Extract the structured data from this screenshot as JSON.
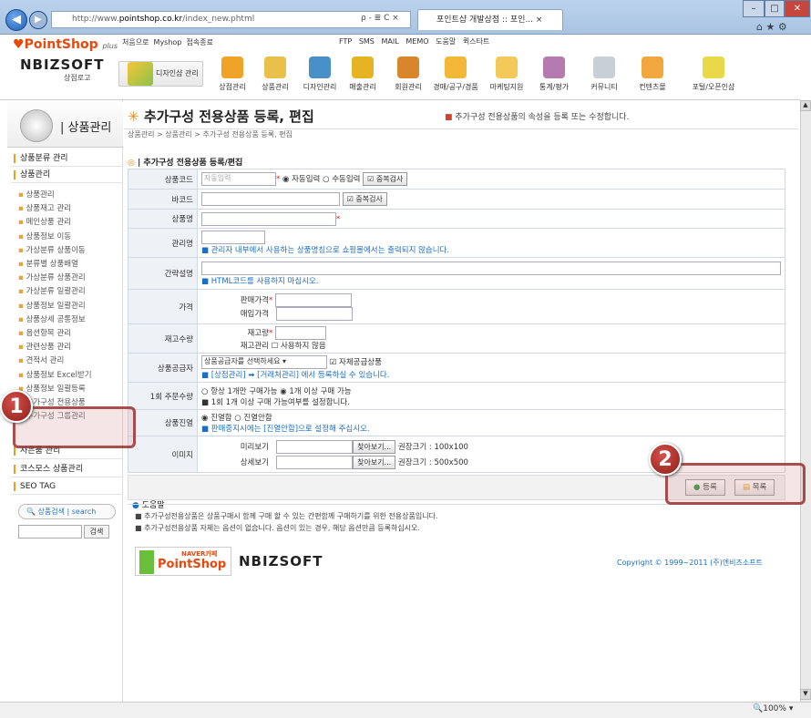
{
  "browser": {
    "url_prefix": "http://www.",
    "url_domain": "pointshop.co.kr",
    "url_path": "/index_new.phtml",
    "search_glyph": "ρ - ≣ C ×",
    "tab_title": "포인트샵 개발상점 :: 포인...",
    "tab_close": "×"
  },
  "site": {
    "logo": "PointShop",
    "logo_sub": "plus",
    "toplinks": [
      "처음으로",
      "Myshop",
      "접속종료"
    ],
    "rightlinks": [
      "FTP",
      "SMS",
      "MAIL",
      "MEMO",
      "도움말",
      "퀵스타트"
    ],
    "company": "NBIZSOFT",
    "company_sub": "상점로고"
  },
  "menu": {
    "current": "디자인샵 관리",
    "items": [
      "상점관리",
      "상품관리",
      "디자인관리",
      "매출관리",
      "회원관리",
      "경매/공구/경품",
      "마케팅지원",
      "통계/평가",
      "커뮤니티",
      "컨텐츠몰",
      "포털/오픈인샵"
    ]
  },
  "sidebar": {
    "title": "상품관리",
    "groups": [
      {
        "label": "상품분류 관리"
      },
      {
        "label": "상품관리"
      }
    ],
    "items": [
      "상품관리",
      "상품재고 관리",
      "메인상품 관리",
      "상품정보 이동",
      "가상분류 상품이동",
      "분류별 상품배열",
      "가상분류 상품관리",
      "가상분류 일괄관리",
      "상품정보 일괄관리",
      "상품상세 공통정보",
      "옵션항목 관리",
      "관련상품 관리",
      "견적서 관리",
      "상품정보 Excel받기",
      "상품정보 일괄등록",
      "추가구성 전용상품",
      "추가구성 그룹관리"
    ],
    "bottom_groups": [
      "사은품 관리",
      "코스모스 상품관리",
      "SEO TAG"
    ],
    "search_label": "상품검색 | search",
    "search_button": "검색"
  },
  "page": {
    "title": "추가구성 전용상품 등록, 편집",
    "desc": "추가구성 전용상품의 속성을 등록 또는 수정합니다.",
    "breadcrumb": "상품관리 > 상품관리 > 추가구성 전용상품 등록, 편집",
    "section": "추가구성 전용상품 등록/편집"
  },
  "form": {
    "code_label": "상품코드",
    "code_placeholder": "자동입력",
    "auto": "자동입력",
    "manual": "수동입력",
    "dup_check": "중복검사",
    "barcode_label": "바코드",
    "name_label": "상품명",
    "mgmt_label": "관리명",
    "mgmt_note": "관리자 내부에서 사용하는 상품명칭으로 쇼핑몰에서는 출력되지 않습니다.",
    "desc_label": "간략설명",
    "desc_note": "HTML코드를 사용하지 마십시오.",
    "price_label": "가격",
    "sell_price": "판매가격",
    "buy_price": "매입가격",
    "stock_label": "재고수량",
    "stock": "재고량",
    "stock_mgmt": "재고관리",
    "stock_nouse": "사용하지 않음",
    "supplier_label": "상품공급자",
    "supplier_select": "상품공급자를 선택하세요",
    "self_supply": "자체공급상품",
    "supplier_note": "[상점관리] ➡ [거래처관리] 에서 등록하실 수 있습니다.",
    "order_label": "1회 주문수량",
    "order_opt1": "항상 1개만 구매가능",
    "order_opt2": "1개 이상 구매 가능",
    "order_note": "1회 1개 이상 구매 가능여부를 설정합니다.",
    "display_label": "상품진열",
    "display_on": "진열함",
    "display_off": "진열안함",
    "display_note": "판매중지시에는 [진열안함]으로 설정해 주십시오.",
    "image_label": "이미지",
    "preview": "미리보기",
    "detail": "상세보기",
    "browse": "찾아보기...",
    "preview_size": "권장크기 : 100x100",
    "detail_size": "권장크기 : 500x500"
  },
  "actions": {
    "register": "등록",
    "list": "목록"
  },
  "help": {
    "title": "도움말",
    "lines": [
      "추가구성전용상품은 상품구매시 함께 구매 할 수 있는 간편함께 구매하기를 위한 전용상품입니다.",
      "추가구성전용상품 자체는 옵션이 없습니다. 옵션이 있는 경우, 해당 옵션만큼 등록하십시오."
    ]
  },
  "footer": {
    "naver": "NAVER카페",
    "copyright": "Copyright © 1999~2011 (주)엔비즈소프트"
  },
  "callouts": [
    "1",
    "2"
  ],
  "status": {
    "zoom": "100%"
  }
}
